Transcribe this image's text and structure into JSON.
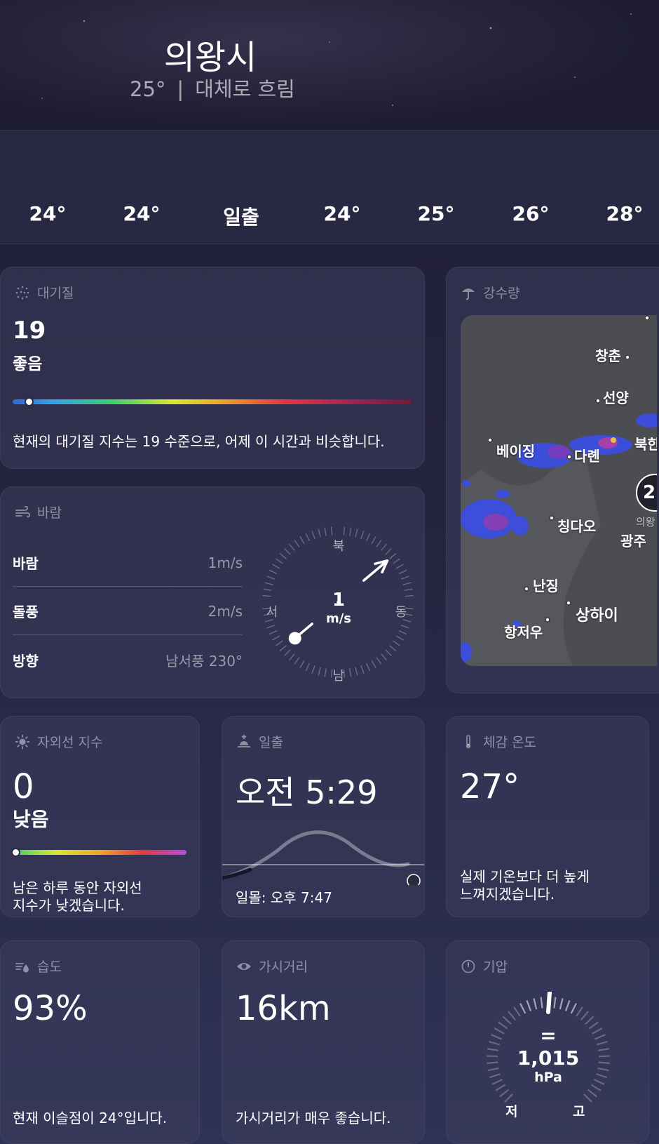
{
  "header": {
    "city": "의왕시",
    "temp": "25°",
    "separator": "|",
    "condition": "대체로 흐림"
  },
  "hourly": [
    "24°",
    "24°",
    "일출",
    "24°",
    "25°",
    "26°",
    "28°"
  ],
  "air_quality": {
    "title": "대기질",
    "value": "19",
    "label": "좋음",
    "level_fraction": 0.04,
    "description": "현재의 대기질 지수는 19 수준으로, 어제 이 시간과 비슷합니다."
  },
  "precipitation": {
    "title": "강수량",
    "cities": [
      "창춘",
      "선양",
      "베이징",
      "다롄",
      "북한",
      "칭다오",
      "의왕",
      "광주",
      "난징",
      "상하이",
      "항저우"
    ],
    "badge": "2"
  },
  "wind": {
    "title": "바람",
    "rows": [
      {
        "key": "바람",
        "value": "1m/s"
      },
      {
        "key": "돌풍",
        "value": "2m/s"
      },
      {
        "key": "방향",
        "value": "남서풍 230°"
      }
    ],
    "compass": {
      "north": "북",
      "south": "남",
      "east": "동",
      "west": "서",
      "speed": "1",
      "unit": "m/s",
      "direction_deg": 230
    }
  },
  "uv": {
    "title": "자외선 지수",
    "value": "0",
    "label": "낮음",
    "level_fraction": 0.0,
    "description_line1": "남은 하루 동안 자외선",
    "description_line2": "지수가 낮겠습니다."
  },
  "sunrise": {
    "title": "일출",
    "value": "오전 5:29",
    "sunset": "일몰: 오후 7:47"
  },
  "feels_like": {
    "title": "체감 온도",
    "value": "27°",
    "description_line1": "실제 기온보다 더 높게",
    "description_line2": "느껴지겠습니다."
  },
  "humidity": {
    "title": "습도",
    "value": "93%",
    "description": "현재 이슬점이 24°입니다."
  },
  "visibility": {
    "title": "가시거리",
    "value": "16km",
    "description": "가시거리가 매우 좋습니다."
  },
  "pressure": {
    "title": "기압",
    "trend": "=",
    "value": "1,015",
    "unit": "hPa",
    "low": "저",
    "high": "고"
  },
  "colors": {
    "accent": "#ffffff",
    "card_bg": "#3c3d5c",
    "muted": "#9a9ab0"
  }
}
